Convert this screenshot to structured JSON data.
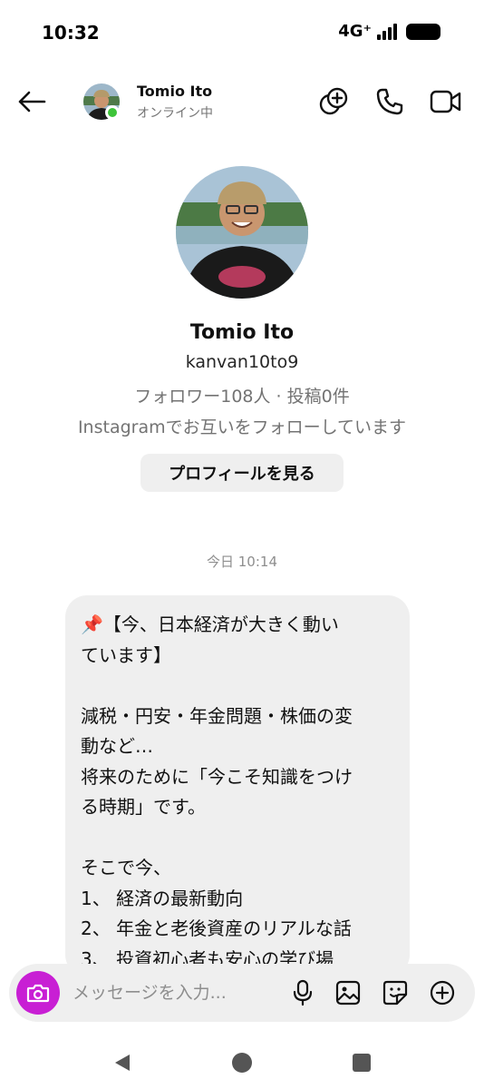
{
  "status_bar": {
    "time": "10:32",
    "network": "4G⁺"
  },
  "header": {
    "name": "Tomio Ito",
    "status": "オンライン中",
    "icons": [
      "back-arrow-icon",
      "add-effects-icon",
      "phone-icon",
      "video-camera-icon"
    ]
  },
  "profile": {
    "name": "Tomio Ito",
    "username": "kanvan10to9",
    "stats": "フォロワー108人 · 投稿0件",
    "mutual": "Instagramでお互いをフォローしています",
    "view_profile_label": "プロフィールを見る"
  },
  "thread": {
    "timestamp": "今日 10:14",
    "messages": [
      {
        "text": "📌【今、日本経済が大きく動い\nています】\n\n減税・円安・年金問題・株価の変\n動など…\n将来のために「今こそ知識をつけ\nる時期」です。\n\nそこで今、\n1、 経済の最新動向\n2、 年金と老後資産のリアルな話\n3、 投資初心者も安心の学び場"
      }
    ]
  },
  "composer": {
    "placeholder": "メッセージを入力...",
    "value": "",
    "icons": [
      "camera-icon",
      "microphone-icon",
      "gallery-icon",
      "sticker-icon",
      "plus-circle-icon"
    ],
    "camera_color": "#c81fd4"
  },
  "navigation": {
    "buttons": [
      "back-triangle-icon",
      "home-circle-icon",
      "recents-square-icon"
    ]
  },
  "colors": {
    "online": "#3ec43a",
    "bubble": "#efefef",
    "accent": "#c81fd4"
  }
}
